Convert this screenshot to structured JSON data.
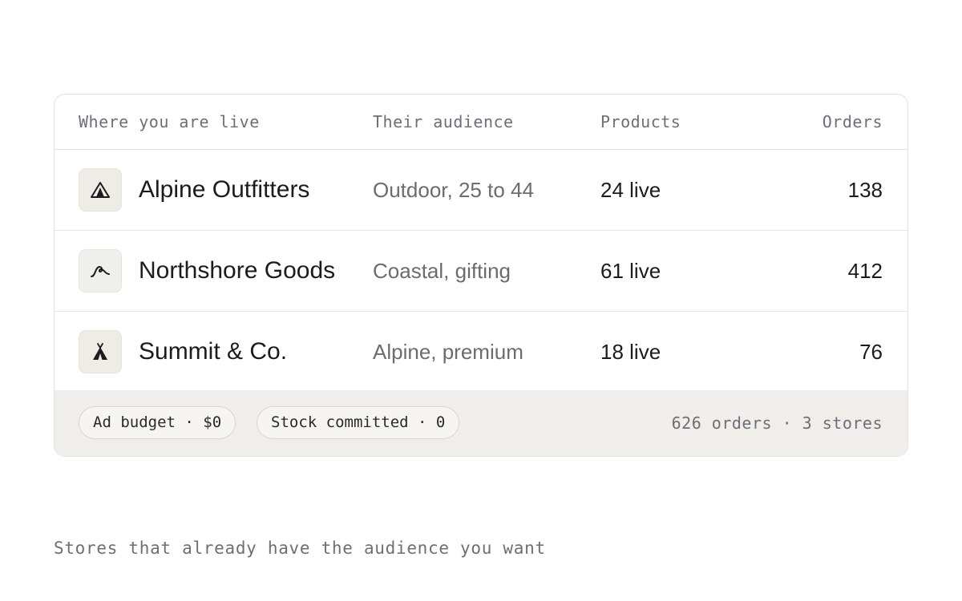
{
  "table": {
    "columns": {
      "store": "Where you are live",
      "audience": "Their audience",
      "products": "Products",
      "orders": "Orders"
    },
    "rows": [
      {
        "icon": "tent-icon",
        "store": "Alpine Outfitters",
        "audience": "Outdoor, 25 to 44",
        "products": "24 live",
        "orders": "138"
      },
      {
        "icon": "wave-icon",
        "store": "Northshore Goods",
        "audience": "Coastal, gifting",
        "products": "61 live",
        "orders": "412"
      },
      {
        "icon": "teepee-icon",
        "store": "Summit & Co.",
        "audience": "Alpine, premium",
        "products": "18 live",
        "orders": "76"
      }
    ]
  },
  "footer": {
    "ad_budget": "Ad budget · $0",
    "stock_committed": "Stock committed · 0",
    "summary": "626 orders · 3 stores"
  },
  "caption": "Stores that already have the audience you want"
}
